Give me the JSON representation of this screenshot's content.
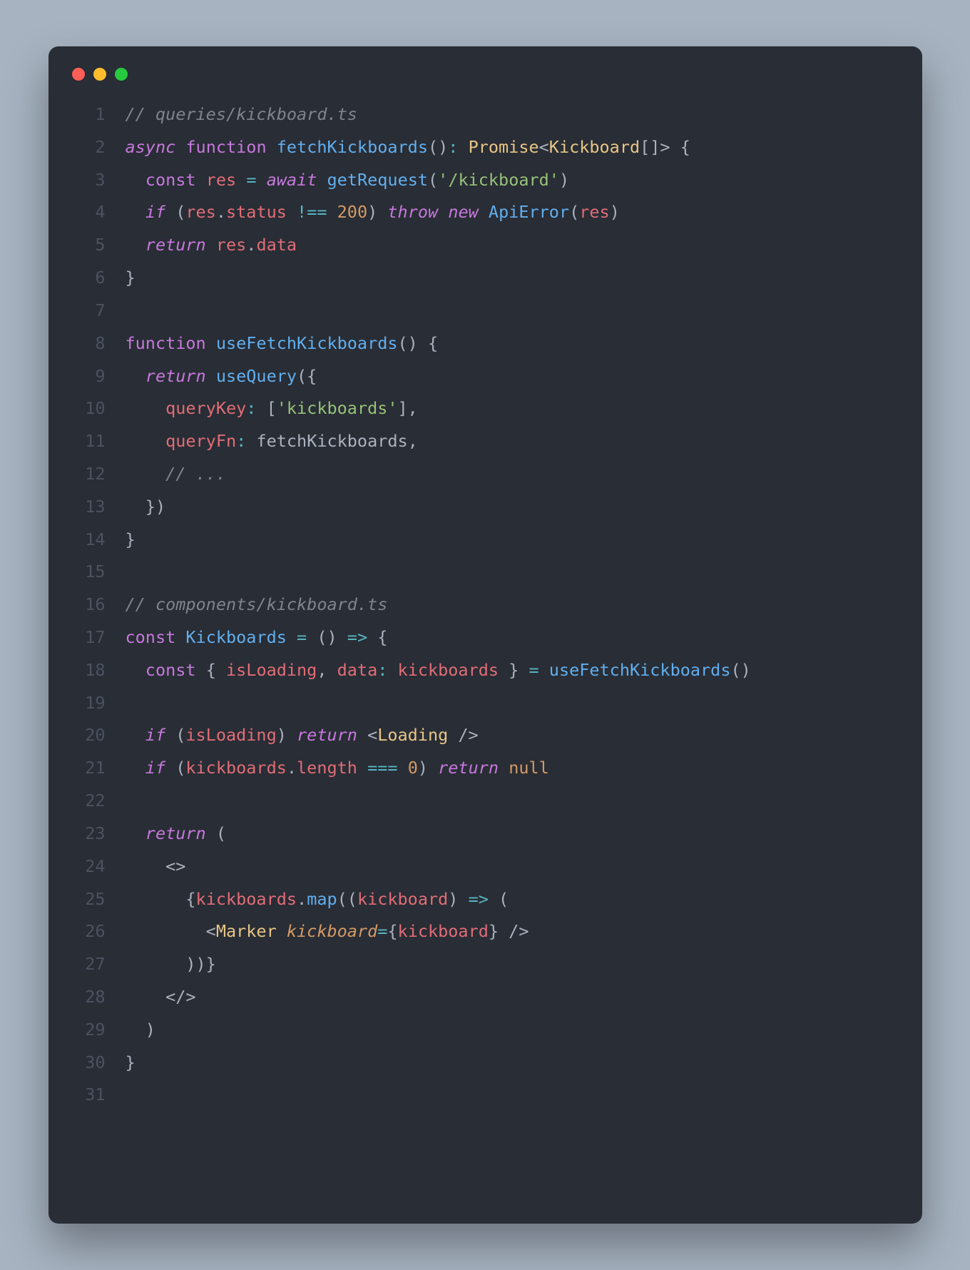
{
  "traffic_lights": [
    "#ff5f56",
    "#ffbd2e",
    "#27c93f"
  ],
  "code": [
    {
      "n": 1,
      "tokens": [
        [
          "c-comment",
          "// queries/kickboard.ts"
        ]
      ]
    },
    {
      "n": 2,
      "tokens": [
        [
          "c-kw",
          "async"
        ],
        [
          "c-pun",
          " "
        ],
        [
          "c-kwp",
          "function"
        ],
        [
          "c-pun",
          " "
        ],
        [
          "c-fn",
          "fetchKickboards"
        ],
        [
          "c-pun",
          "()"
        ],
        [
          "c-op",
          ":"
        ],
        [
          "c-pun",
          " "
        ],
        [
          "c-type",
          "Promise"
        ],
        [
          "c-pun",
          "<"
        ],
        [
          "c-type",
          "Kickboard"
        ],
        [
          "c-pun",
          "[]> {"
        ]
      ]
    },
    {
      "n": 3,
      "tokens": [
        [
          "c-pun",
          "  "
        ],
        [
          "c-kwp",
          "const"
        ],
        [
          "c-pun",
          " "
        ],
        [
          "c-var",
          "res"
        ],
        [
          "c-pun",
          " "
        ],
        [
          "c-op",
          "="
        ],
        [
          "c-pun",
          " "
        ],
        [
          "c-kw",
          "await"
        ],
        [
          "c-pun",
          " "
        ],
        [
          "c-fn",
          "getRequest"
        ],
        [
          "c-pun",
          "("
        ],
        [
          "c-str",
          "'/kickboard'"
        ],
        [
          "c-pun",
          ")"
        ]
      ]
    },
    {
      "n": 4,
      "tokens": [
        [
          "c-pun",
          "  "
        ],
        [
          "c-kw",
          "if"
        ],
        [
          "c-pun",
          " ("
        ],
        [
          "c-var",
          "res"
        ],
        [
          "c-pun",
          "."
        ],
        [
          "c-var",
          "status"
        ],
        [
          "c-pun",
          " "
        ],
        [
          "c-op",
          "!=="
        ],
        [
          "c-pun",
          " "
        ],
        [
          "c-num",
          "200"
        ],
        [
          "c-pun",
          ") "
        ],
        [
          "c-kw",
          "throw"
        ],
        [
          "c-pun",
          " "
        ],
        [
          "c-kw",
          "new"
        ],
        [
          "c-pun",
          " "
        ],
        [
          "c-fn",
          "ApiError"
        ],
        [
          "c-pun",
          "("
        ],
        [
          "c-var",
          "res"
        ],
        [
          "c-pun",
          ")"
        ]
      ]
    },
    {
      "n": 5,
      "tokens": [
        [
          "c-pun",
          "  "
        ],
        [
          "c-kw",
          "return"
        ],
        [
          "c-pun",
          " "
        ],
        [
          "c-var",
          "res"
        ],
        [
          "c-pun",
          "."
        ],
        [
          "c-var",
          "data"
        ]
      ]
    },
    {
      "n": 6,
      "tokens": [
        [
          "c-pun",
          "}"
        ]
      ]
    },
    {
      "n": 7,
      "tokens": []
    },
    {
      "n": 8,
      "tokens": [
        [
          "c-kwp",
          "function"
        ],
        [
          "c-pun",
          " "
        ],
        [
          "c-fn",
          "useFetchKickboards"
        ],
        [
          "c-pun",
          "() {"
        ]
      ]
    },
    {
      "n": 9,
      "tokens": [
        [
          "c-pun",
          "  "
        ],
        [
          "c-kw",
          "return"
        ],
        [
          "c-pun",
          " "
        ],
        [
          "c-fn",
          "useQuery"
        ],
        [
          "c-pun",
          "({"
        ]
      ]
    },
    {
      "n": 10,
      "tokens": [
        [
          "c-pun",
          "    "
        ],
        [
          "c-var",
          "queryKey"
        ],
        [
          "c-op",
          ":"
        ],
        [
          "c-pun",
          " ["
        ],
        [
          "c-str",
          "'kickboards'"
        ],
        [
          "c-pun",
          "],"
        ]
      ]
    },
    {
      "n": 11,
      "tokens": [
        [
          "c-pun",
          "    "
        ],
        [
          "c-var",
          "queryFn"
        ],
        [
          "c-op",
          ":"
        ],
        [
          "c-pun",
          " "
        ],
        [
          "c-varf",
          "fetchKickboards"
        ],
        [
          "c-pun",
          ","
        ]
      ]
    },
    {
      "n": 12,
      "tokens": [
        [
          "c-pun",
          "    "
        ],
        [
          "c-comment",
          "// ..."
        ]
      ]
    },
    {
      "n": 13,
      "tokens": [
        [
          "c-pun",
          "  })"
        ]
      ]
    },
    {
      "n": 14,
      "tokens": [
        [
          "c-pun",
          "}"
        ]
      ]
    },
    {
      "n": 15,
      "tokens": []
    },
    {
      "n": 16,
      "tokens": [
        [
          "c-comment",
          "// components/kickboard.ts"
        ]
      ]
    },
    {
      "n": 17,
      "tokens": [
        [
          "c-kwp",
          "const"
        ],
        [
          "c-pun",
          " "
        ],
        [
          "c-fn",
          "Kickboards"
        ],
        [
          "c-pun",
          " "
        ],
        [
          "c-op",
          "="
        ],
        [
          "c-pun",
          " () "
        ],
        [
          "c-op",
          "=>"
        ],
        [
          "c-pun",
          " {"
        ]
      ]
    },
    {
      "n": 18,
      "tokens": [
        [
          "c-pun",
          "  "
        ],
        [
          "c-kwp",
          "const"
        ],
        [
          "c-pun",
          " { "
        ],
        [
          "c-var",
          "isLoading"
        ],
        [
          "c-pun",
          ", "
        ],
        [
          "c-var",
          "data"
        ],
        [
          "c-op",
          ":"
        ],
        [
          "c-pun",
          " "
        ],
        [
          "c-var",
          "kickboards"
        ],
        [
          "c-pun",
          " } "
        ],
        [
          "c-op",
          "="
        ],
        [
          "c-pun",
          " "
        ],
        [
          "c-fn",
          "useFetchKickboards"
        ],
        [
          "c-pun",
          "()"
        ]
      ]
    },
    {
      "n": 19,
      "tokens": []
    },
    {
      "n": 20,
      "tokens": [
        [
          "c-pun",
          "  "
        ],
        [
          "c-kw",
          "if"
        ],
        [
          "c-pun",
          " ("
        ],
        [
          "c-var",
          "isLoading"
        ],
        [
          "c-pun",
          ") "
        ],
        [
          "c-kw",
          "return"
        ],
        [
          "c-pun",
          " <"
        ],
        [
          "c-jsx",
          "Loading"
        ],
        [
          "c-pun",
          " />"
        ]
      ]
    },
    {
      "n": 21,
      "tokens": [
        [
          "c-pun",
          "  "
        ],
        [
          "c-kw",
          "if"
        ],
        [
          "c-pun",
          " ("
        ],
        [
          "c-var",
          "kickboards"
        ],
        [
          "c-pun",
          "."
        ],
        [
          "c-var",
          "length"
        ],
        [
          "c-pun",
          " "
        ],
        [
          "c-op",
          "==="
        ],
        [
          "c-pun",
          " "
        ],
        [
          "c-num",
          "0"
        ],
        [
          "c-pun",
          ") "
        ],
        [
          "c-kw",
          "return"
        ],
        [
          "c-pun",
          " "
        ],
        [
          "c-num",
          "null"
        ]
      ]
    },
    {
      "n": 22,
      "tokens": []
    },
    {
      "n": 23,
      "tokens": [
        [
          "c-pun",
          "  "
        ],
        [
          "c-kw",
          "return"
        ],
        [
          "c-pun",
          " ("
        ]
      ]
    },
    {
      "n": 24,
      "tokens": [
        [
          "c-pun",
          "    <>"
        ]
      ]
    },
    {
      "n": 25,
      "tokens": [
        [
          "c-pun",
          "      {"
        ],
        [
          "c-var",
          "kickboards"
        ],
        [
          "c-pun",
          "."
        ],
        [
          "c-fn",
          "map"
        ],
        [
          "c-pun",
          "(("
        ],
        [
          "c-var",
          "kickboard"
        ],
        [
          "c-pun",
          ") "
        ],
        [
          "c-op",
          "=>"
        ],
        [
          "c-pun",
          " ("
        ]
      ]
    },
    {
      "n": 26,
      "tokens": [
        [
          "c-pun",
          "        <"
        ],
        [
          "c-jsx",
          "Marker"
        ],
        [
          "c-pun",
          " "
        ],
        [
          "c-attr",
          "kickboard"
        ],
        [
          "c-op",
          "="
        ],
        [
          "c-pun",
          "{"
        ],
        [
          "c-var",
          "kickboard"
        ],
        [
          "c-pun",
          "} />"
        ]
      ]
    },
    {
      "n": 27,
      "tokens": [
        [
          "c-pun",
          "      ))}"
        ]
      ]
    },
    {
      "n": 28,
      "tokens": [
        [
          "c-pun",
          "    </>"
        ]
      ]
    },
    {
      "n": 29,
      "tokens": [
        [
          "c-pun",
          "  )"
        ]
      ]
    },
    {
      "n": 30,
      "tokens": [
        [
          "c-pun",
          "}"
        ]
      ]
    },
    {
      "n": 31,
      "tokens": []
    }
  ]
}
